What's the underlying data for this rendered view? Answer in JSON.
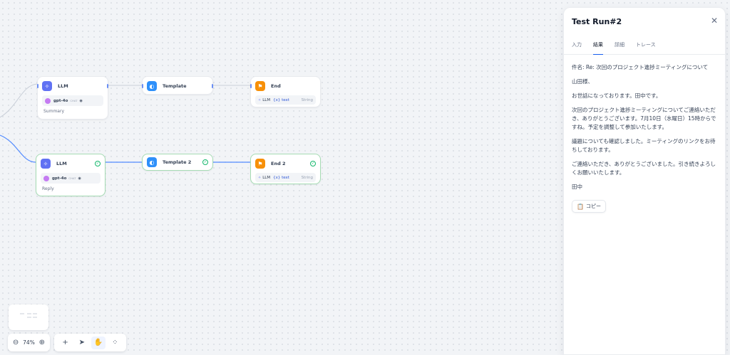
{
  "nodes": {
    "llm1": {
      "title": "LLM",
      "model": "gpt-4o",
      "mode": "CHAT",
      "subtitle": "Summary"
    },
    "template1": {
      "title": "Template"
    },
    "end1": {
      "title": "End",
      "var_source": "LLM",
      "var_name": "{x} text",
      "var_type": "String"
    },
    "llm2": {
      "title": "LLM",
      "model": "gpt-4o",
      "mode": "CHAT",
      "subtitle": "Reply"
    },
    "template2": {
      "title": "Template 2"
    },
    "end2": {
      "title": "End 2",
      "var_source": "LLM",
      "var_name": "{x} text",
      "var_type": "String"
    }
  },
  "zoom": {
    "value": "74%"
  },
  "panel": {
    "title": "Test Run#2",
    "tabs": [
      {
        "label": "入力"
      },
      {
        "label": "結果",
        "active": true
      },
      {
        "label": "詳細"
      },
      {
        "label": "トレース"
      }
    ],
    "result": [
      "件名: Re: 次回のプロジェクト進捗ミーティングについて",
      "山田様、",
      "お世話になっております。田中です。",
      "次回のプロジェクト進捗ミーティングについてご連絡いただき、ありがとうございます。7月10日（水曜日）15時からですね。予定を調整して参加いたします。",
      "議題についても確認しました。ミーティングのリンクをお待ちしております。",
      "ご連絡いただき、ありがとうございました。引き続きよろしくお願いいたします。",
      "田中"
    ],
    "copy_label": "コピー"
  },
  "icons": {
    "zoom_out": "zoom-out-icon",
    "zoom_in": "zoom-in-icon",
    "add": "plus-icon",
    "pointer": "pointer-icon",
    "hand": "hand-icon",
    "organize": "organize-icon",
    "close": "close-icon",
    "copy": "clipboard-icon"
  },
  "colors": {
    "accent": "#155eef",
    "success": "#12b76a",
    "llm": "#6172f3",
    "template": "#2e90fa",
    "end": "#f79009"
  }
}
